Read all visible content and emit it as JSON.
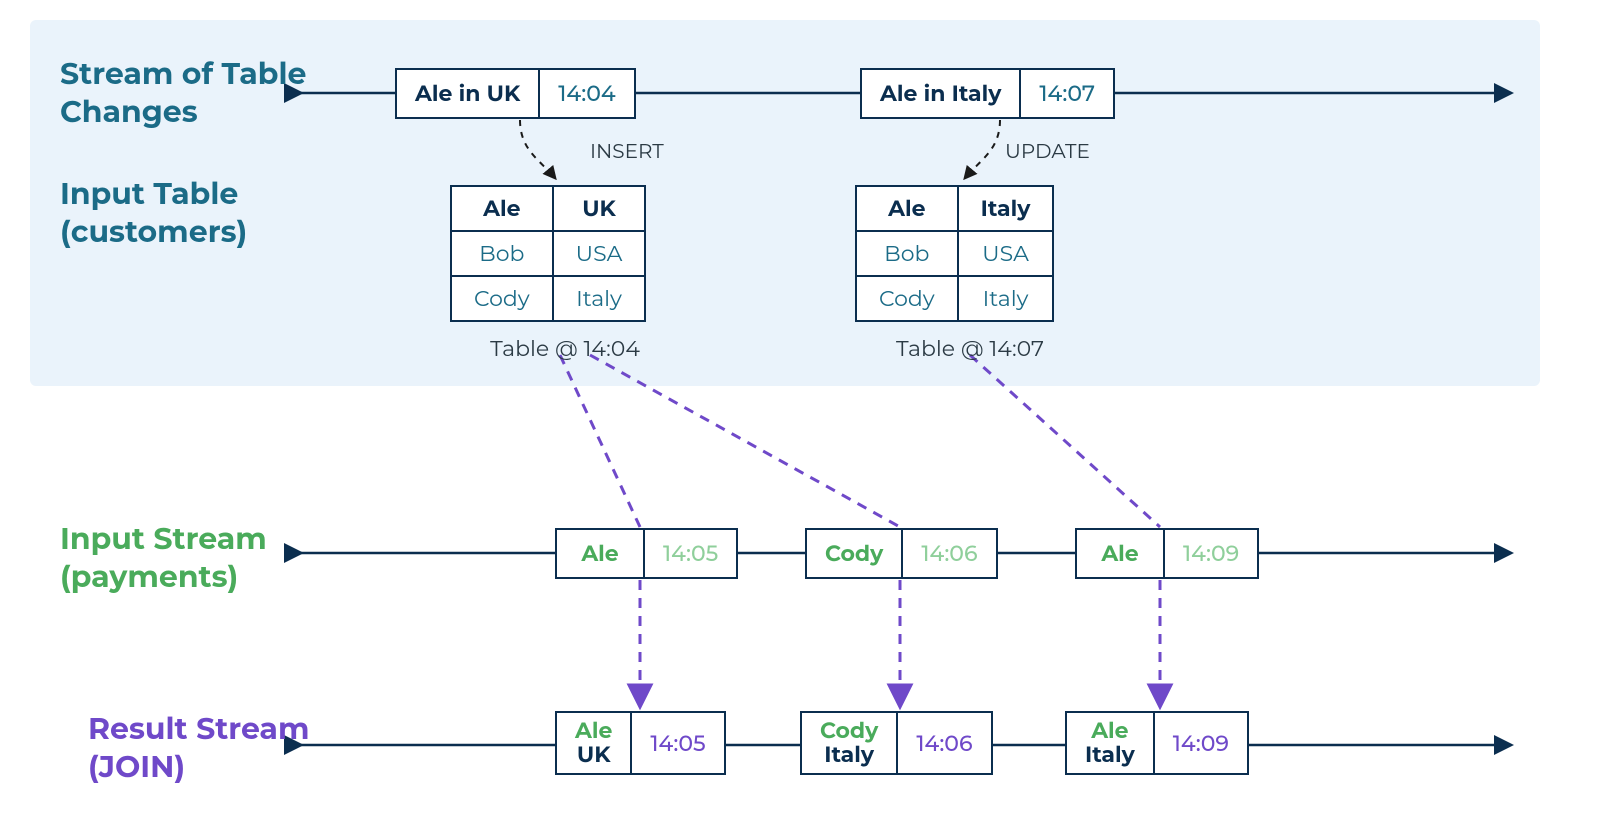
{
  "labels": {
    "stream_changes": "Stream of Table\nChanges",
    "input_table": "Input Table\n(customers)",
    "input_stream": "Input Stream\n(payments)",
    "result_stream": "Result Stream\n(JOIN)"
  },
  "ops": {
    "insert": "INSERT",
    "update": "UPDATE"
  },
  "changes": [
    {
      "text": "Ale in UK",
      "time": "14:04"
    },
    {
      "text": "Ale in Italy",
      "time": "14:07"
    }
  ],
  "tables": {
    "t1": {
      "rows": [
        {
          "name": "Ale",
          "country": "UK",
          "hi": true
        },
        {
          "name": "Bob",
          "country": "USA",
          "hi": false
        },
        {
          "name": "Cody",
          "country": "Italy",
          "hi": false
        }
      ],
      "caption": "Table @ 14:04"
    },
    "t2": {
      "rows": [
        {
          "name": "Ale",
          "country": "Italy",
          "hi": true
        },
        {
          "name": "Bob",
          "country": "USA",
          "hi": false
        },
        {
          "name": "Cody",
          "country": "Italy",
          "hi": false
        }
      ],
      "caption": "Table @ 14:07"
    }
  },
  "payments": [
    {
      "name": "Ale",
      "time": "14:05"
    },
    {
      "name": "Cody",
      "time": "14:06"
    },
    {
      "name": "Ale",
      "time": "14:09"
    }
  ],
  "results": [
    {
      "name": "Ale",
      "country": "UK",
      "time": "14:05"
    },
    {
      "name": "Cody",
      "country": "Italy",
      "time": "14:06"
    },
    {
      "name": "Ale",
      "country": "Italy",
      "time": "14:09"
    }
  ]
}
